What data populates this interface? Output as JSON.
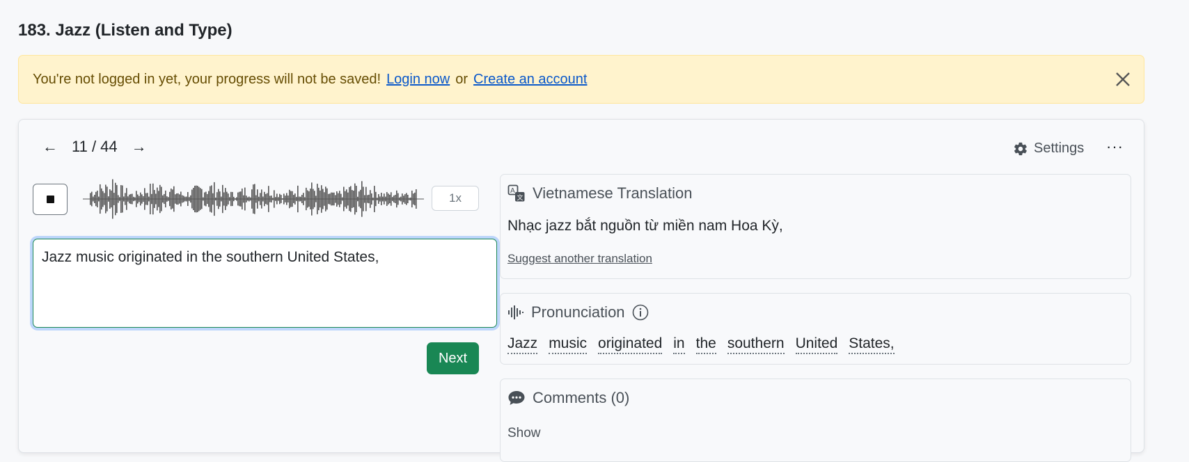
{
  "page": {
    "title": "183. Jazz (Listen and Type)"
  },
  "alert": {
    "message": "You're not logged in yet, your progress will not be saved!",
    "login_link": "Login now",
    "or_text": "or",
    "create_link": "Create an account",
    "bg_color": "#fff3cd"
  },
  "nav": {
    "prev": "←",
    "counter": "11 / 44",
    "next": "→"
  },
  "toolbar": {
    "settings_label": "Settings",
    "more_label": "···"
  },
  "player": {
    "speed": "1x"
  },
  "answer": {
    "value": "Jazz music originated in the southern United States,"
  },
  "next_button": {
    "label": "Next",
    "color": "#198754"
  },
  "translation": {
    "heading": "Vietnamese Translation",
    "text": "Nhạc jazz bắt nguồn từ miền nam Hoa Kỳ,",
    "suggest_label": "Suggest another translation"
  },
  "pronunciation": {
    "heading": "Pronunciation",
    "words": [
      "Jazz",
      "music",
      "originated",
      "in",
      "the",
      "southern",
      "United",
      "States,"
    ]
  },
  "comments": {
    "heading": "Comments (0)",
    "show_label": "Show"
  }
}
